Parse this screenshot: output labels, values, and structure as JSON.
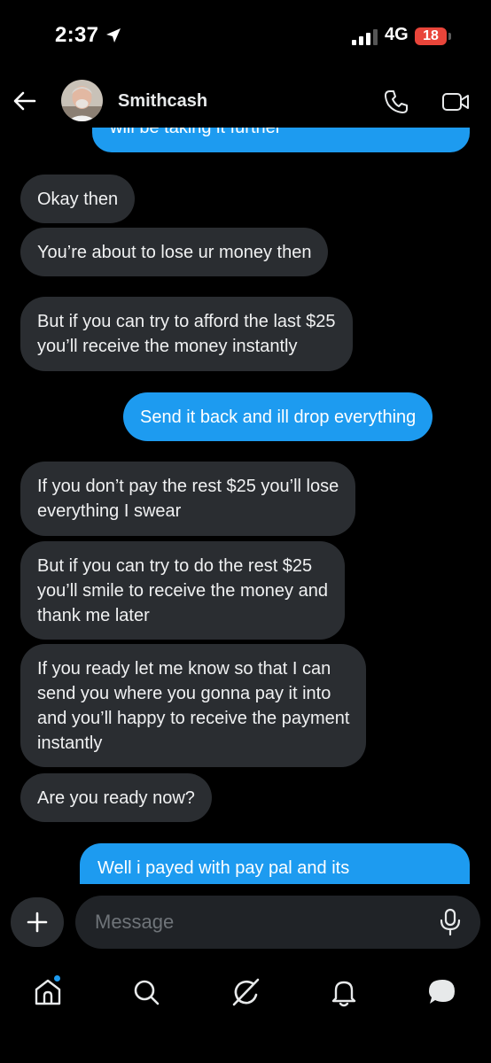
{
  "status_bar": {
    "time": "2:37",
    "network": "4G",
    "battery": "18"
  },
  "header": {
    "contact_name": "Smithcash"
  },
  "messages": [
    {
      "direction": "sent",
      "text": "will be taking it further",
      "partial": "top-cut"
    },
    {
      "direction": "received",
      "lines": [
        "Okay then"
      ]
    },
    {
      "direction": "received",
      "lines": [
        "You’re about to lose ur money then"
      ]
    },
    {
      "direction": "received",
      "lines": [
        "But if you can try to afford the last $25",
        "you’ll receive the money instantly"
      ]
    },
    {
      "direction": "sent",
      "lines": [
        "Send it back and ill drop everything"
      ]
    },
    {
      "direction": "received",
      "lines": [
        "If you don’t pay the rest $25 you’ll lose",
        "everything I swear"
      ]
    },
    {
      "direction": "received",
      "lines": [
        "But if you can try to do the rest $25",
        "you’ll smile to receive the money and",
        "thank me later"
      ]
    },
    {
      "direction": "received",
      "lines": [
        "If you ready let me know so that I can",
        "send you where you gonna pay it into",
        "and you’ll happy to receive the payment",
        "instantly"
      ]
    },
    {
      "direction": "received",
      "lines": [
        "Are you ready now?"
      ]
    },
    {
      "direction": "sent",
      "text": "Well i payed with pay pal and its",
      "partial": "bottom-cut"
    }
  ],
  "composer": {
    "placeholder": "Message"
  },
  "nav": {
    "items": [
      "home-icon",
      "search-icon",
      "grok-icon",
      "notifications-icon",
      "messages-icon"
    ],
    "home_has_dot": true
  },
  "colors": {
    "sent_bubble": "#1d9bf0",
    "received_bubble": "#2a2d31",
    "background": "#000000",
    "battery_low": "#e9453a"
  }
}
